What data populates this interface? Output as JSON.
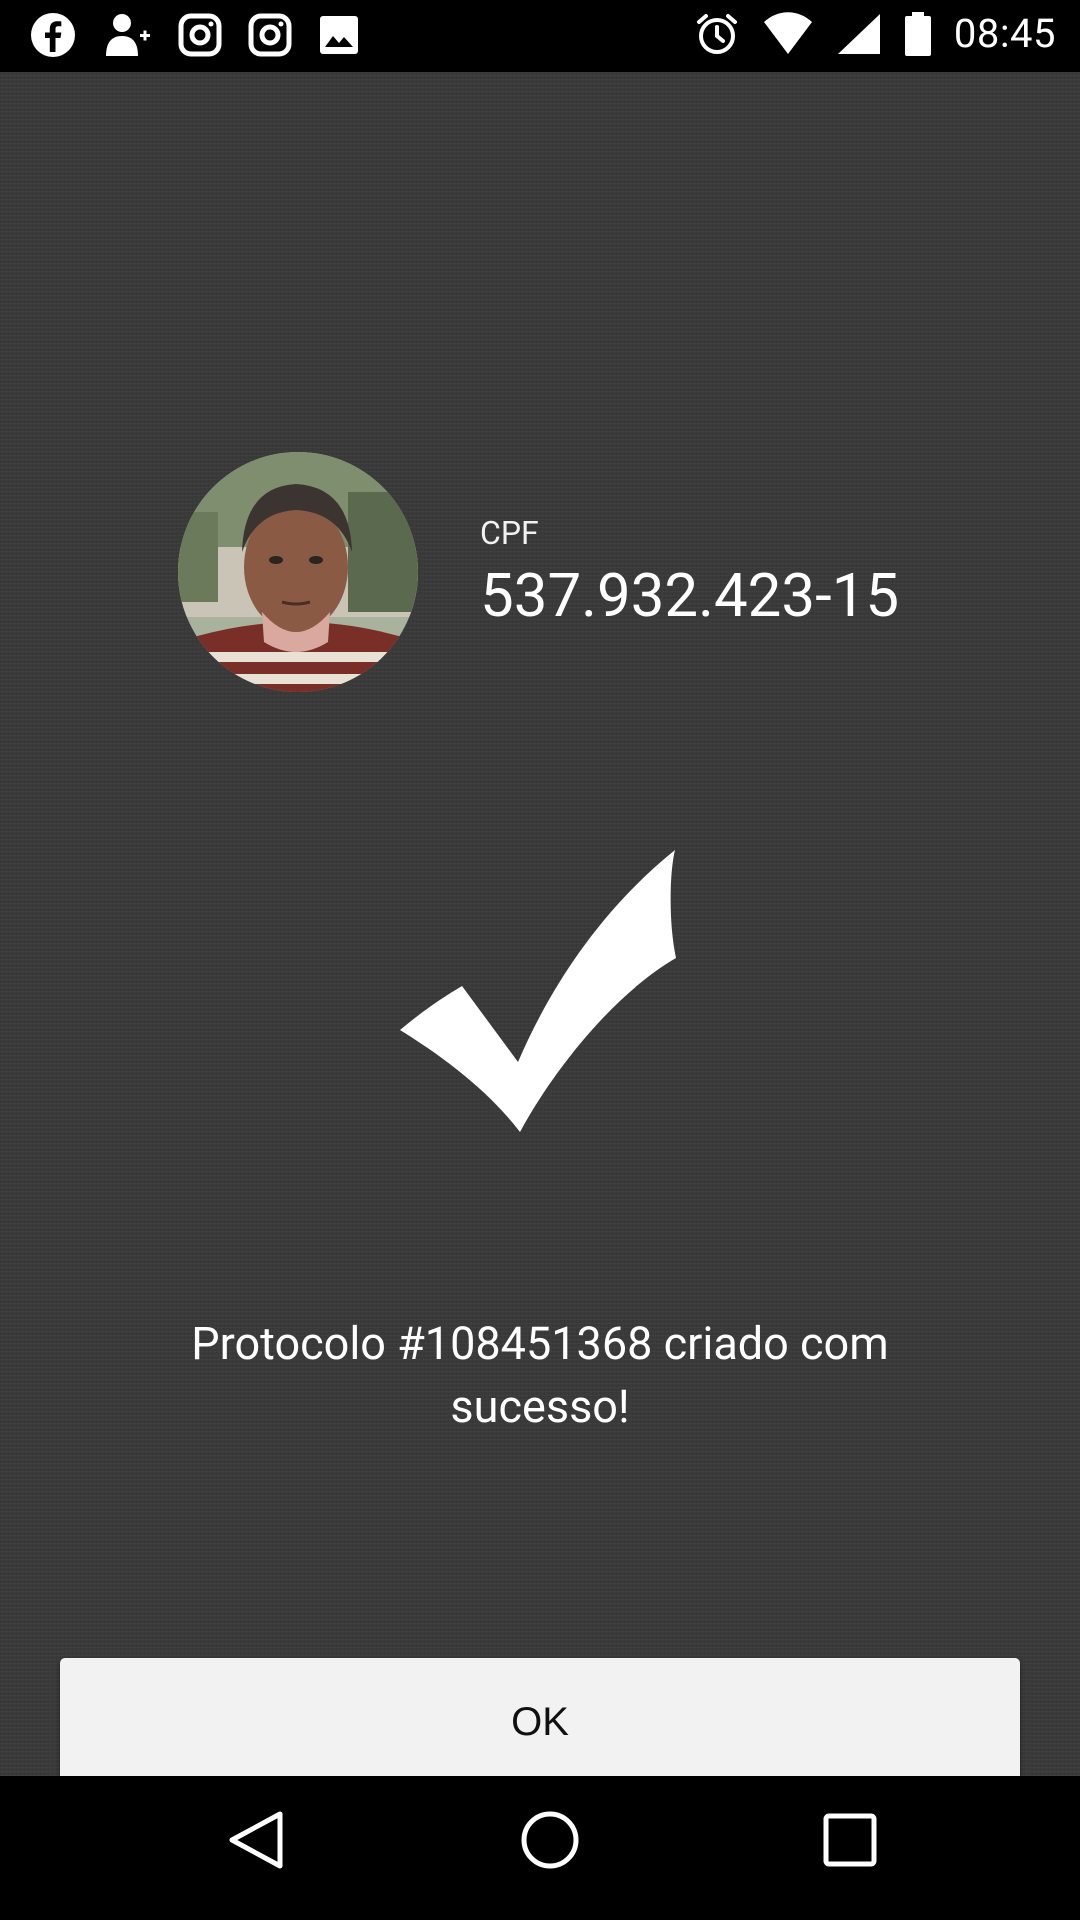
{
  "status_bar": {
    "time": "08:45",
    "left_icons": [
      "facebook-icon",
      "add-contact-icon",
      "instagram-icon",
      "instagram-icon",
      "gallery-icon"
    ],
    "right_icons": [
      "alarm-icon",
      "wifi-icon",
      "signal-icon",
      "battery-icon"
    ]
  },
  "profile": {
    "cpf_label": "CPF",
    "cpf_value": "537.932.423-15"
  },
  "message": "Protocolo #108451368 criado com sucesso!",
  "ok_button": {
    "label": "OK"
  },
  "nav_bar": {
    "buttons": [
      "back-icon",
      "home-icon",
      "recents-icon"
    ]
  },
  "colors": {
    "background": "#3a3a3a",
    "button": "#f2f2f2",
    "bars": "#000000"
  }
}
